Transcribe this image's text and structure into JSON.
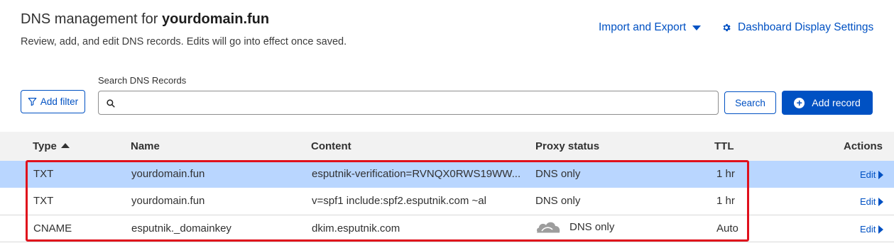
{
  "header": {
    "title_prefix": "DNS management for ",
    "domain": "yourdomain.fun",
    "subtitle": "Review, add, and edit DNS records. Edits will go into effect once saved."
  },
  "top_actions": {
    "import_export": "Import and Export",
    "dashboard_settings": "Dashboard Display Settings"
  },
  "search": {
    "label": "Search DNS Records",
    "value": "",
    "placeholder": "",
    "button": "Search"
  },
  "buttons": {
    "add_filter": "Add filter",
    "add_record": "Add record"
  },
  "table": {
    "columns": {
      "type": "Type",
      "name": "Name",
      "content": "Content",
      "proxy": "Proxy status",
      "ttl": "TTL",
      "actions": "Actions"
    },
    "sort": {
      "column": "Type",
      "direction": "ascending"
    },
    "rows": [
      {
        "type": "TXT",
        "name": "yourdomain.fun",
        "content": "esputnik-verification=RVNQX0RWS19WW...",
        "proxy": "DNS only",
        "ttl": "1 hr",
        "edit": "Edit",
        "selected": true
      },
      {
        "type": "TXT",
        "name": "yourdomain.fun",
        "content": "v=spf1 include:spf2.esputnik.com ~al",
        "proxy": "DNS only",
        "ttl": "1 hr",
        "edit": "Edit",
        "selected": false
      },
      {
        "type": "CNAME",
        "name": "esputnik._domainkey",
        "content": "dkim.esputnik.com",
        "proxy": "DNS only",
        "proxy_icon": "grey-cloud-icon",
        "ttl": "Auto",
        "edit": "Edit",
        "selected": false
      }
    ]
  },
  "colors": {
    "accent": "#0051c3",
    "selected_row": "#b9d6ff",
    "highlight_border": "#e0101c",
    "header_bg": "#f2f2f2"
  }
}
